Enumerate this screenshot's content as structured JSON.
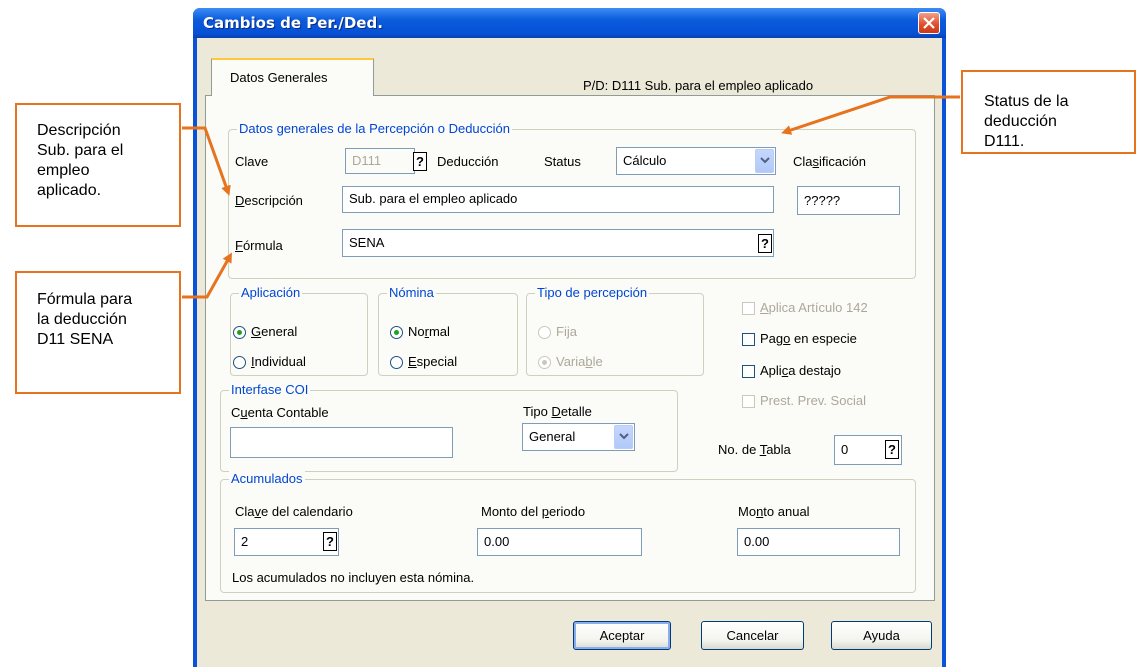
{
  "window": {
    "title": "Cambios de Per./Ded."
  },
  "tab": {
    "label": "Datos Generales"
  },
  "pd_header": "P/D: D111  Sub. para el empleo aplicado",
  "general": {
    "legend": "Datos generales de la Percepción o Deducción",
    "clave_label": "Clave",
    "clave_value": "D111",
    "tipo_text": "Deducción",
    "status_label": "Status",
    "status_value": "Cálculo",
    "clasificacion_label": "Clasificación",
    "clasificacion_value": "?????",
    "descripcion_label": "Descripción",
    "descripcion_value": "Sub. para el empleo aplicado",
    "formula_label": "Fórmula",
    "formula_value": "SENA"
  },
  "aplicacion": {
    "legend": "Aplicación",
    "general": "General",
    "individual": "Individual",
    "selected": "General"
  },
  "nomina": {
    "legend": "Nómina",
    "normal": "Normal",
    "especial": "Especial",
    "selected": "Normal"
  },
  "tipo_percepcion": {
    "legend": "Tipo de percepción",
    "fija": "Fija",
    "variable": "Variable",
    "selected": "Variable"
  },
  "checks": {
    "articulo142": "Aplica Artículo 142",
    "pago_especie": "Pago en especie",
    "destajo": "Aplica destajo",
    "prev_social": "Prest. Prev. Social"
  },
  "coi": {
    "legend": "Interfase COI",
    "cuenta_label": "Cuenta Contable",
    "cuenta_value": "",
    "tipo_detalle_label": "Tipo Detalle",
    "tipo_detalle_value": "General"
  },
  "tabla": {
    "label": "No. de Tabla",
    "value": "0"
  },
  "acumulados": {
    "legend": "Acumulados",
    "clave_cal_label": "Clave del calendario",
    "clave_cal_value": "2",
    "monto_periodo_label": "Monto del periodo",
    "monto_periodo_value": "0.00",
    "monto_anual_label": "Monto anual",
    "monto_anual_value": "0.00",
    "note": "Los acumulados no incluyen esta nómina."
  },
  "buttons": {
    "aceptar": "Aceptar",
    "cancelar": "Cancelar",
    "ayuda": "Ayuda"
  },
  "callouts": {
    "descripcion": "Descripción\nSub. para el\nempleo\naplicado.",
    "formula": "Fórmula para\nla deducción\nD11 SENA",
    "status": "Status de la\ndeducción\nD111."
  },
  "colors": {
    "accent": "#e6731e",
    "title_bar": "#0651d6",
    "legend": "#0046d5"
  }
}
